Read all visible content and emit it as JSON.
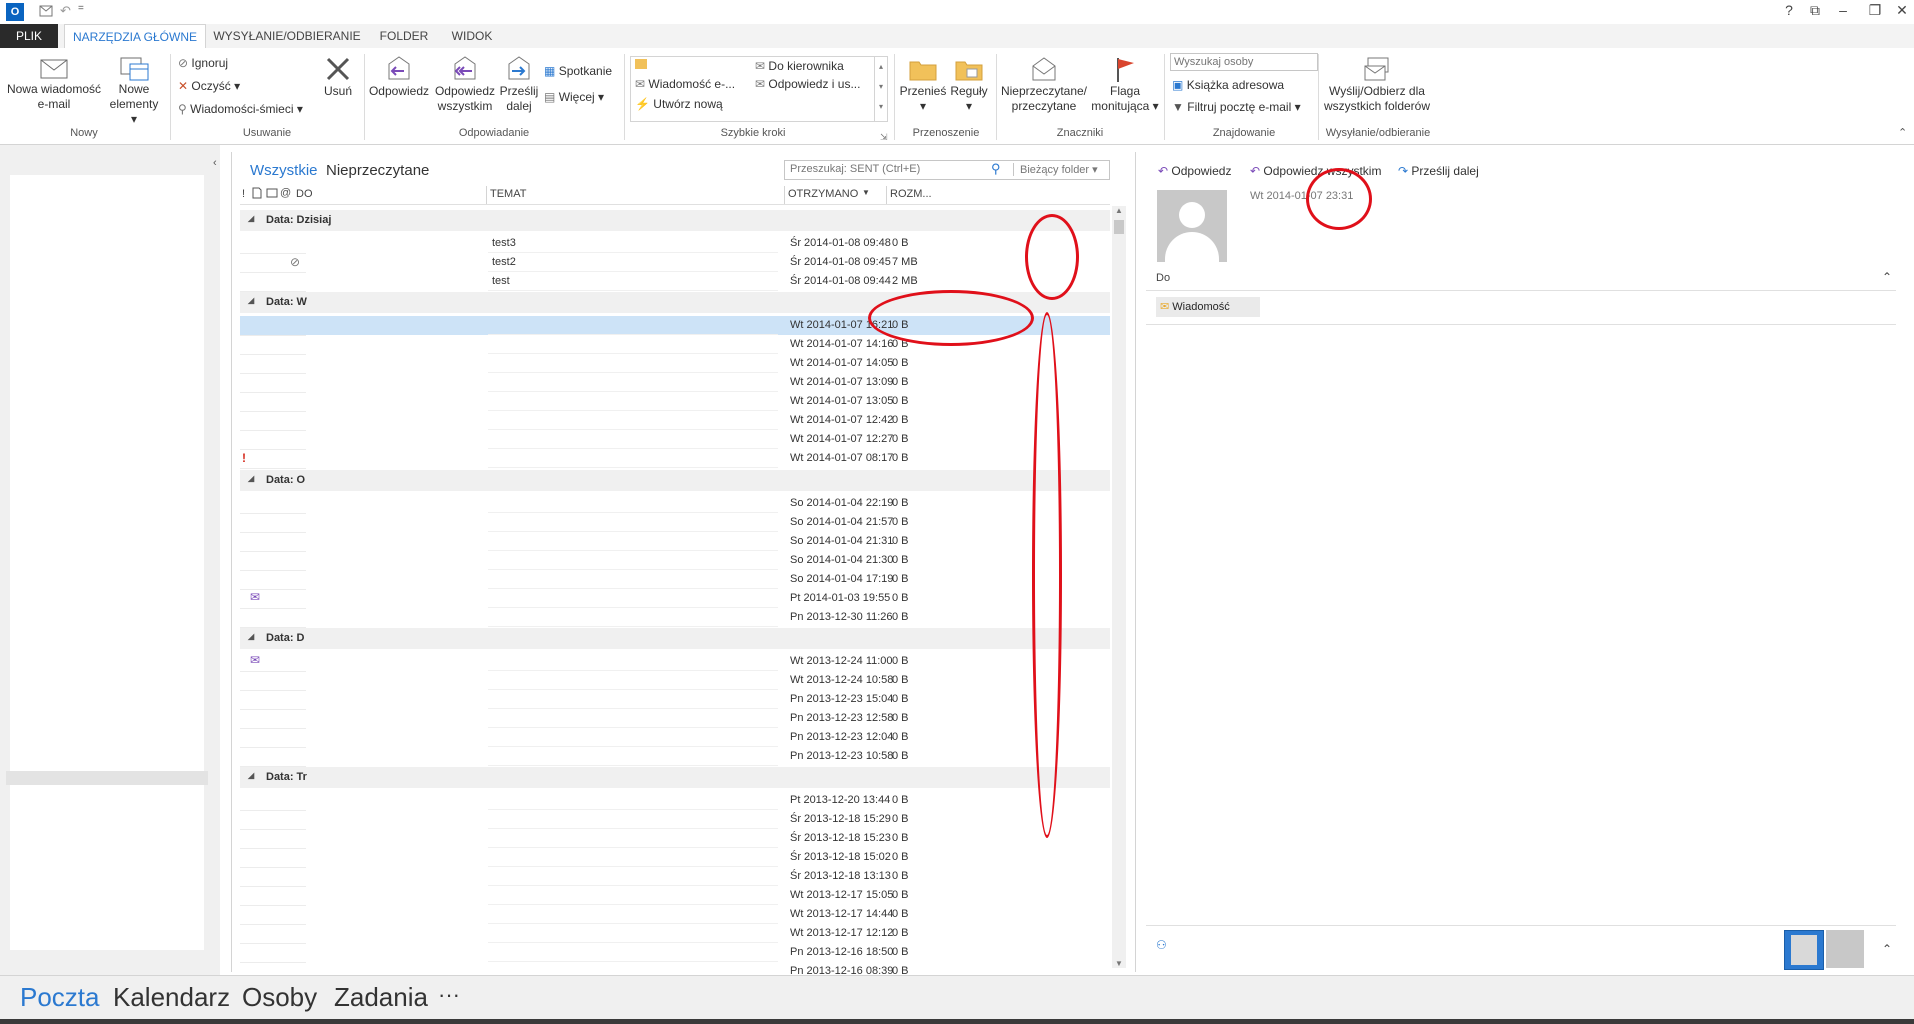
{
  "quick_access": {
    "undo": "↶",
    "more": "="
  },
  "window": {
    "help": "?",
    "restore_ribbon": "⧉",
    "minimize": "–",
    "maximize": "❐",
    "close": "✕"
  },
  "tabs": [
    {
      "label": "PLIK"
    },
    {
      "label": "NARZĘDZIA GŁÓWNE"
    },
    {
      "label": "WYSYŁANIE/ODBIERANIE"
    },
    {
      "label": "FOLDER"
    },
    {
      "label": "WIDOK"
    }
  ],
  "ribbon": {
    "new_email_l1": "Nowa wiadomość",
    "new_email_l2": "e-mail",
    "new_items_l1": "Nowe",
    "new_items_l2": "elementy",
    "group_new": "Nowy",
    "ignore": "Ignoruj",
    "clean": "Oczyść",
    "junk": "Wiadomości-śmieci",
    "delete": "Usuń",
    "group_delete": "Usuwanie",
    "reply": "Odpowiedz",
    "reply_all_l1": "Odpowiedz",
    "reply_all_l2": "wszystkim",
    "forward_l1": "Prześlij",
    "forward_l2": "dalej",
    "meeting": "Spotkanie",
    "more": "Więcej",
    "group_respond": "Odpowiadanie",
    "qs_1": "Wiadomość e-...",
    "qs_2": "Do kierownika",
    "qs_3": "Odpowiedz i us...",
    "qs_4": "Utwórz nową",
    "group_quicksteps": "Szybkie kroki",
    "move": "Przenieś",
    "rules": "Reguły",
    "group_move": "Przenoszenie",
    "unread_l1": "Nieprzeczytane/",
    "unread_l2": "przeczytane",
    "flag_l1": "Flaga",
    "flag_l2": "monitująca",
    "group_tags": "Znaczniki",
    "search_people_placeholder": "Wyszukaj osoby",
    "address_book": "Książka adresowa",
    "filter_email": "Filtruj pocztę e-mail",
    "group_find": "Znajdowanie",
    "send_receive_l1": "Wyślij/Odbierz dla",
    "send_receive_l2": "wszystkich folderów",
    "group_send_receive": "Wysyłanie/odbieranie"
  },
  "list": {
    "filter_all": "Wszystkie",
    "filter_unread": "Nieprzeczytane",
    "search_placeholder": "Przeszukaj: SENT (Ctrl+E)",
    "scope": "Bieżący folder",
    "col_importance": "!",
    "col_to": "DO",
    "col_subject": "TEMAT",
    "col_received": "OTRZYMANO",
    "col_size": "ROZM..."
  },
  "groups": [
    {
      "label": "Data: Dzisiaj"
    },
    {
      "label": "Data: W"
    },
    {
      "label": "Data: O"
    },
    {
      "label": "Data: D"
    },
    {
      "label": "Data: Tr"
    }
  ],
  "rows": [
    {
      "subject": "test3",
      "received": "Śr 2014-01-08 09:48",
      "size": "0 B"
    },
    {
      "subject": "test2",
      "received": "Śr 2014-01-08 09:45",
      "size": "7 MB"
    },
    {
      "subject": "test",
      "received": "Śr 2014-01-08 09:44",
      "size": "2 MB"
    },
    {
      "subject": "",
      "received": "Wt 2014-01-07 16:21",
      "size": "0 B"
    },
    {
      "subject": "",
      "received": "Wt 2014-01-07 14:16",
      "size": "0 B"
    },
    {
      "subject": "",
      "received": "Wt 2014-01-07 14:05",
      "size": "0 B"
    },
    {
      "subject": "",
      "received": "Wt 2014-01-07 13:09",
      "size": "0 B"
    },
    {
      "subject": "",
      "received": "Wt 2014-01-07 13:05",
      "size": "0 B"
    },
    {
      "subject": "",
      "received": "Wt 2014-01-07 12:42",
      "size": "0 B"
    },
    {
      "subject": "",
      "received": "Wt 2014-01-07 12:27",
      "size": "0 B"
    },
    {
      "subject": "",
      "received": "Wt 2014-01-07 08:17",
      "size": "0 B"
    },
    {
      "subject": "",
      "received": "So 2014-01-04 22:19",
      "size": "0 B"
    },
    {
      "subject": "",
      "received": "So 2014-01-04 21:57",
      "size": "0 B"
    },
    {
      "subject": "",
      "received": "So 2014-01-04 21:31",
      "size": "0 B"
    },
    {
      "subject": "",
      "received": "So 2014-01-04 21:30",
      "size": "0 B"
    },
    {
      "subject": "",
      "received": "So 2014-01-04 17:19",
      "size": "0 B"
    },
    {
      "subject": "",
      "received": "Pt 2014-01-03 19:55",
      "size": "0 B"
    },
    {
      "subject": "",
      "received": "Pn 2013-12-30 11:26",
      "size": "0 B"
    },
    {
      "subject": "",
      "received": "Wt 2013-12-24 11:00",
      "size": "0 B"
    },
    {
      "subject": "",
      "received": "Wt 2013-12-24 10:58",
      "size": "0 B"
    },
    {
      "subject": "",
      "received": "Pn 2013-12-23 15:04",
      "size": "0 B"
    },
    {
      "subject": "",
      "received": "Pn 2013-12-23 12:58",
      "size": "0 B"
    },
    {
      "subject": "",
      "received": "Pn 2013-12-23 12:04",
      "size": "0 B"
    },
    {
      "subject": "",
      "received": "Pn 2013-12-23 10:58",
      "size": "0 B"
    },
    {
      "subject": "",
      "received": "Pt 2013-12-20 13:44",
      "size": "0 B"
    },
    {
      "subject": "",
      "received": "Śr 2013-12-18 15:29",
      "size": "0 B"
    },
    {
      "subject": "",
      "received": "Śr 2013-12-18 15:23",
      "size": "0 B"
    },
    {
      "subject": "",
      "received": "Śr 2013-12-18 15:02",
      "size": "0 B"
    },
    {
      "subject": "",
      "received": "Śr 2013-12-18 13:13",
      "size": "0 B"
    },
    {
      "subject": "",
      "received": "Wt 2013-12-17 15:05",
      "size": "0 B"
    },
    {
      "subject": "",
      "received": "Wt 2013-12-17 14:44",
      "size": "0 B"
    },
    {
      "subject": "",
      "received": "Wt 2013-12-17 12:12",
      "size": "0 B"
    },
    {
      "subject": "",
      "received": "Pn 2013-12-16 18:50",
      "size": "0 B"
    },
    {
      "subject": "",
      "received": "Pn 2013-12-16 08:39",
      "size": "0 B"
    }
  ],
  "reading": {
    "reply": "Odpowiedz",
    "reply_all": "Odpowiedz wszystkim",
    "forward": "Prześlij dalej",
    "date": "Wt 2014-01-07 23:31",
    "to_label": "Do",
    "message_tab": "Wiadomość"
  },
  "nav": {
    "mail": "Poczta",
    "calendar": "Kalendarz",
    "people": "Osoby",
    "tasks": "Zadania",
    "more": "···"
  },
  "colors": {
    "accent": "#2b79d0",
    "annotation": "#e0101a"
  }
}
